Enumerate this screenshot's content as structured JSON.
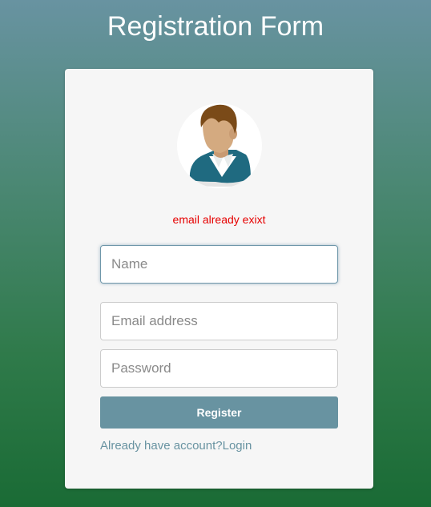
{
  "page": {
    "title": "Registration Form"
  },
  "form": {
    "error_message": "email already exixt",
    "name_field": {
      "placeholder": "Name",
      "value": ""
    },
    "email_field": {
      "placeholder": "Email address",
      "value": ""
    },
    "password_field": {
      "placeholder": "Password",
      "value": ""
    },
    "register_label": "Register",
    "login_link_label": "Already have account?Login"
  },
  "icons": {
    "avatar": "user-avatar-icon"
  },
  "colors": {
    "accent": "#6893a1",
    "error": "#e60000",
    "gradient_top": "#6893a1",
    "gradient_bottom": "#1a6b35",
    "card_background": "#f6f6f6"
  }
}
